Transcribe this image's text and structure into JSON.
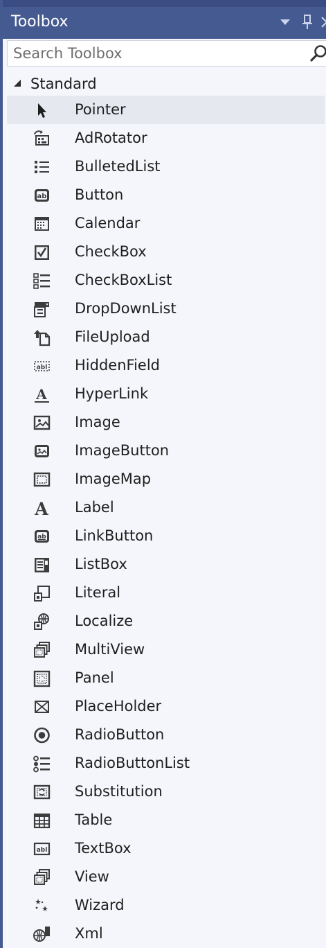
{
  "window": {
    "title": "Toolbox"
  },
  "search": {
    "placeholder": "Search Toolbox"
  },
  "group": {
    "label": "Standard",
    "expanded": true
  },
  "items": [
    {
      "label": "Pointer",
      "icon": "pointer-icon",
      "selected": true
    },
    {
      "label": "AdRotator",
      "icon": "adrotator-icon"
    },
    {
      "label": "BulletedList",
      "icon": "bulletedlist-icon"
    },
    {
      "label": "Button",
      "icon": "button-icon"
    },
    {
      "label": "Calendar",
      "icon": "calendar-icon"
    },
    {
      "label": "CheckBox",
      "icon": "checkbox-icon"
    },
    {
      "label": "CheckBoxList",
      "icon": "checkboxlist-icon"
    },
    {
      "label": "DropDownList",
      "icon": "dropdownlist-icon"
    },
    {
      "label": "FileUpload",
      "icon": "fileupload-icon"
    },
    {
      "label": "HiddenField",
      "icon": "hiddenfield-icon"
    },
    {
      "label": "HyperLink",
      "icon": "hyperlink-icon"
    },
    {
      "label": "Image",
      "icon": "image-icon"
    },
    {
      "label": "ImageButton",
      "icon": "imagebutton-icon"
    },
    {
      "label": "ImageMap",
      "icon": "imagemap-icon"
    },
    {
      "label": "Label",
      "icon": "label-icon"
    },
    {
      "label": "LinkButton",
      "icon": "linkbutton-icon"
    },
    {
      "label": "ListBox",
      "icon": "listbox-icon"
    },
    {
      "label": "Literal",
      "icon": "literal-icon"
    },
    {
      "label": "Localize",
      "icon": "localize-icon"
    },
    {
      "label": "MultiView",
      "icon": "multiview-icon"
    },
    {
      "label": "Panel",
      "icon": "panel-icon"
    },
    {
      "label": "PlaceHolder",
      "icon": "placeholder-icon"
    },
    {
      "label": "RadioButton",
      "icon": "radiobutton-icon"
    },
    {
      "label": "RadioButtonList",
      "icon": "radiobuttonlist-icon"
    },
    {
      "label": "Substitution",
      "icon": "substitution-icon"
    },
    {
      "label": "Table",
      "icon": "table-icon"
    },
    {
      "label": "TextBox",
      "icon": "textbox-icon"
    },
    {
      "label": "View",
      "icon": "view-icon"
    },
    {
      "label": "Wizard",
      "icon": "wizard-icon"
    },
    {
      "label": "Xml",
      "icon": "xml-icon"
    }
  ],
  "colors": {
    "titlebar": "#465a92",
    "background": "#f5f6fb",
    "selected_row": "#e6e8f0",
    "icon_dark": "#3c3c3c"
  }
}
